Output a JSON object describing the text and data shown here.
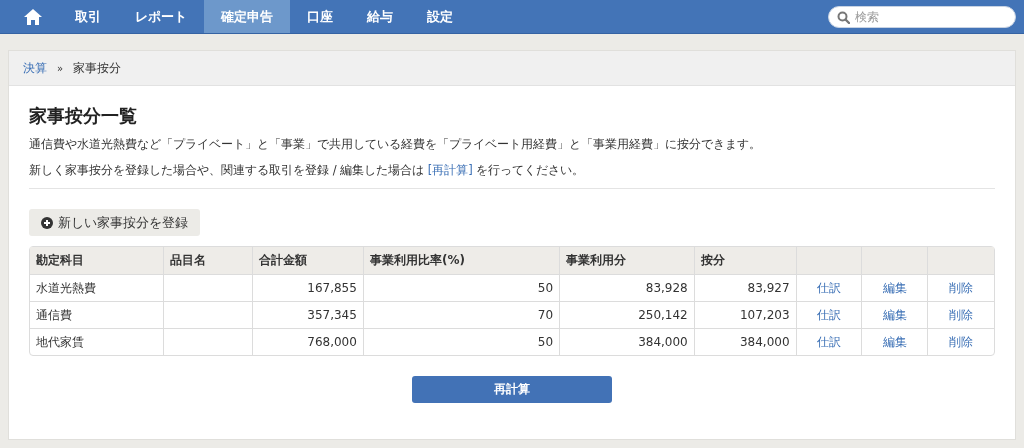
{
  "nav": {
    "tabs": [
      {
        "label": "取引",
        "selected": false
      },
      {
        "label": "レポート",
        "selected": false
      },
      {
        "label": "確定申告",
        "selected": true
      },
      {
        "label": "口座",
        "selected": false
      },
      {
        "label": "給与",
        "selected": false
      },
      {
        "label": "設定",
        "selected": false
      }
    ],
    "search": {
      "placeholder": "検索"
    }
  },
  "breadcrumb": {
    "link": "決算",
    "separator": "»",
    "current": "家事按分"
  },
  "title": "家事按分一覧",
  "intro": "通信費や水道光熱費など「プライベート」と「事業」で共用している経費を「プライベート用経費」と「事業用経費」に按分できます。",
  "note": {
    "before": "新しく家事按分を登録した場合や、関連する取引を登録 / 編集した場合は ",
    "link": "[再計算]",
    "after": " を行ってください。"
  },
  "add_button": "新しい家事按分を登録",
  "table": {
    "columns": [
      "勘定科目",
      "品目名",
      "合計金額",
      "事業利用比率(%)",
      "事業利用分",
      "按分"
    ],
    "rows": [
      {
        "account": "水道光熱費",
        "total": "167,855",
        "ratio": "50",
        "business": "83,928",
        "allocation": "83,927",
        "actions": [
          "仕訳",
          "編集",
          "削除"
        ]
      },
      {
        "account": "通信費",
        "total": "357,345",
        "ratio": "70",
        "business": "250,142",
        "allocation": "107,203",
        "actions": [
          "仕訳",
          "編集",
          "削除"
        ]
      },
      {
        "account": "地代家賃",
        "total": "768,000",
        "ratio": "50",
        "business": "384,000",
        "allocation": "384,000",
        "actions": [
          "仕訳",
          "編集",
          "削除"
        ]
      }
    ]
  },
  "recalc_button": "再計算"
}
